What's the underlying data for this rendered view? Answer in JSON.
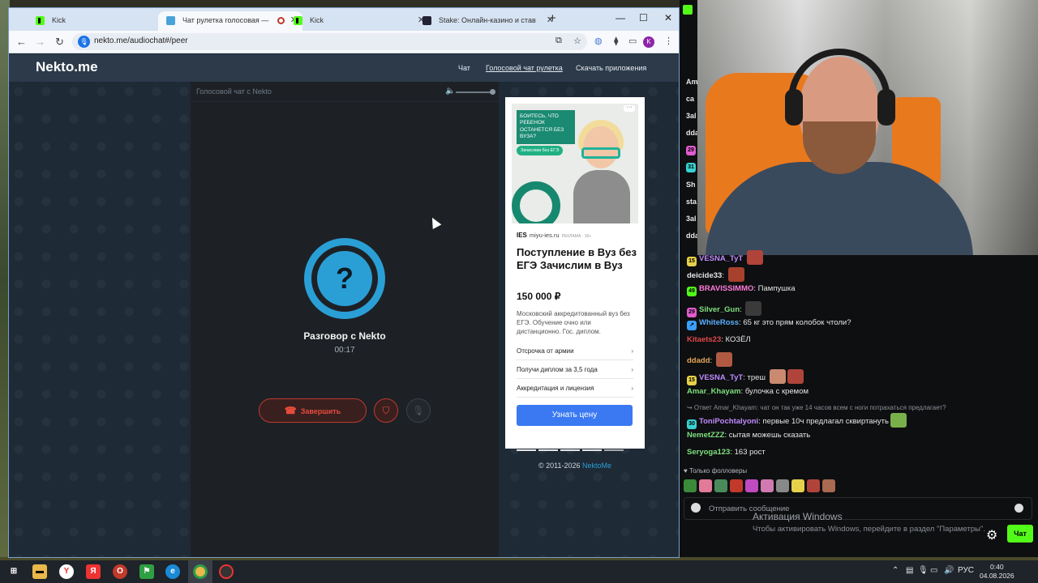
{
  "browser": {
    "tabs": [
      {
        "title": "Kick",
        "icon": "kick-icon",
        "active": false
      },
      {
        "title": "Чат рулетка голосовая —",
        "icon": "nekto-icon",
        "active": true
      },
      {
        "title": "Kick",
        "icon": "kick-icon",
        "active": false
      },
      {
        "title": "Stake: Онлайн-казино и став",
        "icon": "stake-icon",
        "active": false
      }
    ],
    "url": "nekto.me/audiochat#/peer",
    "profile_initial": "K"
  },
  "site": {
    "logo": "Nekto.me",
    "nav": {
      "chat": "Чат",
      "voice_roulette": "Голосовой чат рулетка",
      "download": "Скачать приложения"
    },
    "panel_title": "Голосовой чат с Nekto",
    "avatar_symbol": "?",
    "conversation_title": "Разговор с Nekto",
    "timer": "00:17",
    "end_button": "Завершить",
    "copyright_prefix": "© 2011-2026",
    "copyright_brand": "NektoMe"
  },
  "ad": {
    "image_text": "БОИТЕСЬ, ЧТО РЕБЕНОК ОСТАНЕТСЯ БЕЗ ВУЗА?",
    "image_badge": "Зачислим без ЕГЭ",
    "logo_mark": "IES",
    "domain": "miyu-ies.ru",
    "ad_label": "РЕКЛАМА · 16+",
    "title": "Поступление в Вуз без ЕГЭ Зачислим в Вуз",
    "price": "150 000 ₽",
    "description": "Московский аккредитованный вуз без ЕГЭ. Обучение очно или дистанционно. Гос. диплом.",
    "links": [
      "Отсрочка от армии",
      "Получи диплом за 3,5 года",
      "Аккредитация и лицензия"
    ],
    "cta": "Узнать цену"
  },
  "kick_strip": {
    "users": [
      {
        "text": "Am",
        "color": "#7ee07e"
      },
      {
        "text": "ca",
        "color": "#e8d86a"
      },
      {
        "text": "3al",
        "color": "#c08bff"
      },
      {
        "text": "dda",
        "color": "#e8a85a"
      },
      {
        "text": "Sh",
        "color": "#7ee07e"
      },
      {
        "text": "sta",
        "color": "#5ab0ff"
      },
      {
        "text": "3al",
        "color": "#c08bff"
      },
      {
        "text": "dda",
        "color": "#e8a85a"
      }
    ],
    "badges": [
      "29",
      "31"
    ]
  },
  "chat": {
    "messages": [
      {
        "badge": "15",
        "badge_color": "#e8d14a",
        "user": "VESNA_TyT",
        "user_color": "#c08bff",
        "text": ""
      },
      {
        "badge": "",
        "badge_color": "",
        "user": "deicide33",
        "user_color": "#e6e6e6",
        "text": ""
      },
      {
        "badge": "49",
        "badge_color": "#53fc18",
        "user": "BRAVISSIMMO",
        "user_color": "#ff7ad9",
        "text": "Пампушка"
      },
      {
        "badge": "29",
        "badge_color": "#e05bd0",
        "user": "Silver_Gun",
        "user_color": "#7ee07e",
        "text": ""
      },
      {
        "badge": "↗",
        "badge_color": "#3aa0ff",
        "user": "WhiteRoss",
        "user_color": "#5ab0ff",
        "text": "65 кг это прям колобок чтоли?"
      },
      {
        "badge": "",
        "badge_color": "",
        "user": "Kitaets23",
        "user_color": "#e04a4a",
        "text": "КОЗЁЛ"
      },
      {
        "badge": "",
        "badge_color": "",
        "user": "ddadd",
        "user_color": "#e8a85a",
        "text": ""
      },
      {
        "badge": "15",
        "badge_color": "#e8d14a",
        "user": "VESNA_TyT",
        "user_color": "#c08bff",
        "text": "треш"
      },
      {
        "badge": "",
        "badge_color": "",
        "user": "Amar_Khayam",
        "user_color": "#7ee07e",
        "text": "булочка с кремом"
      },
      {
        "badge": "30",
        "badge_color": "#3ad1d1",
        "user": "ToniPochtalyoni",
        "user_color": "#c08bff",
        "text": "первые 10ч предлагал сквиртануть"
      },
      {
        "badge": "",
        "badge_color": "",
        "user": "NemetZZZ",
        "user_color": "#7ee07e",
        "text": "сытая можешь сказать"
      },
      {
        "badge": "",
        "badge_color": "",
        "user": "Seryoga123",
        "user_color": "#7ee07e",
        "text": "163 рост"
      }
    ],
    "reply_note": "↪ Ответ Amar_Khayam: чат он так уже 14 часов всем с ноги потрахаться предлагает?",
    "followers_only": "♥ Только фолловеры",
    "input_placeholder": "Отправить сообщение",
    "send_button": "Чат"
  },
  "windows": {
    "activation_title": "Активация Windows",
    "activation_text": "Чтобы активировать Windows, перейдите в раздел \"Параметры\".",
    "lang": "РУС",
    "time": "0:40",
    "date": "04.08.2026"
  },
  "colors": {
    "accent_blue": "#2a9fd6",
    "end_red": "#e74c3c",
    "kick_green": "#53fc18",
    "ad_cta": "#3a79f2"
  }
}
